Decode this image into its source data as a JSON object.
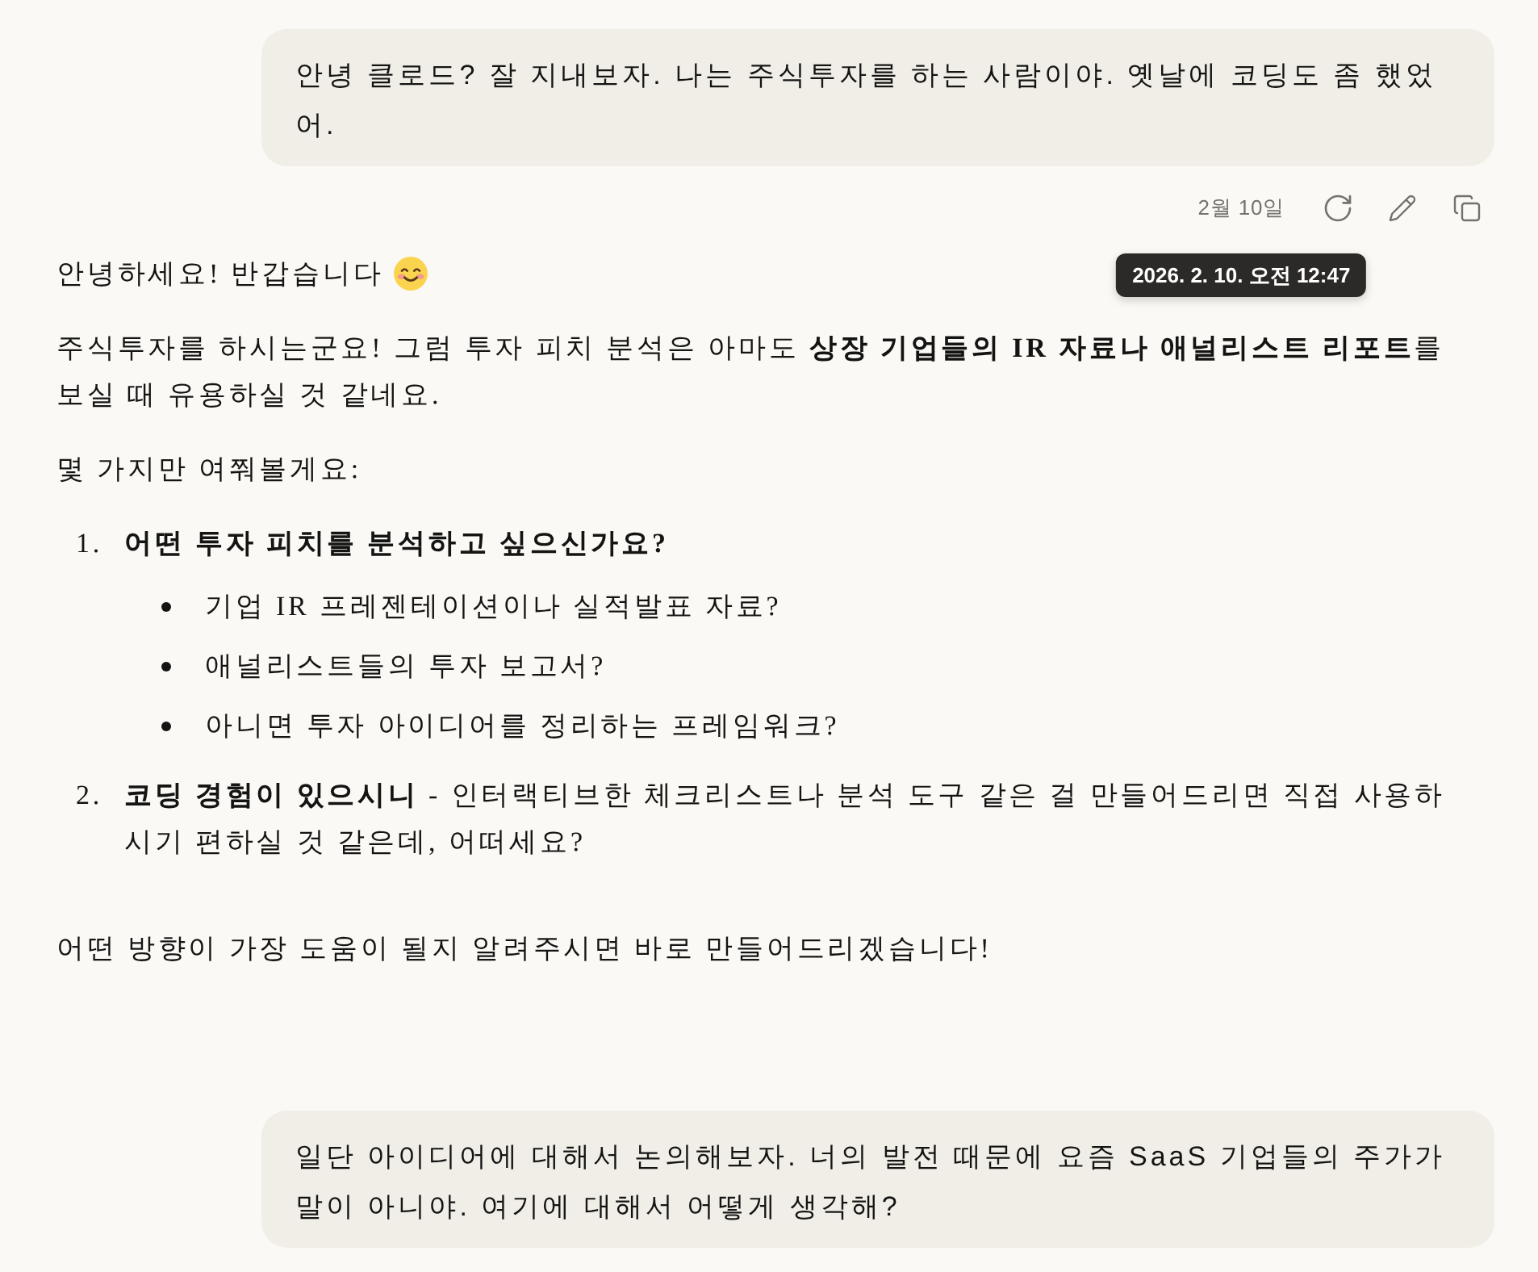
{
  "conversation": [
    {
      "kind": "user_message",
      "text": "안녕 클로드? 잘 지내보자. 나는 주식투자를 하는 사람이야. 옛날에 코딩도 좀 했었어."
    },
    {
      "kind": "message_meta",
      "date": "2월 10일",
      "tooltip": "2026. 2. 10. 오전 12:47"
    },
    {
      "kind": "assistant_message",
      "blocks": [
        {
          "kind": "paragraph",
          "text": "안녕하세요! 반갑습니다",
          "emoji": true
        },
        {
          "kind": "paragraph",
          "text": "주식투자를 하시는군요! 그럼 투자 피치 분석은 아마도 **상장 기업들의 IR 자료나 애널리스트 리포트**를 보실 때 유용하실 것 같네요."
        },
        {
          "kind": "paragraph",
          "text": "몇 가지만 여쭤볼게요:"
        },
        {
          "kind": "numbered_list",
          "items": [
            {
              "number": "1.",
              "text": "**어떤 투자 피치를 분석하고 싶으신가요?**",
              "children": [
                {
                  "text": "기업 IR 프레젠테이션이나 실적발표 자료?"
                },
                {
                  "text": "애널리스트들의 투자 보고서?"
                },
                {
                  "text": "아니면 투자 아이디어를 정리하는 프레임워크?"
                }
              ]
            },
            {
              "number": "2.",
              "text": "**코딩 경험이 있으시니** - 인터랙티브한 체크리스트나 분석 도구 같은 걸 만들어드리면 직접 사용하시기 편하실 것 같은데, 어떠세요?"
            }
          ]
        },
        {
          "kind": "paragraph",
          "text": "어떤 방향이 가장 도움이 될지 알려주시면 바로 만들어드리겠습니다!"
        }
      ]
    },
    {
      "kind": "user_message",
      "text": "일단 아이디어에 대해서 논의해보자. 너의 발전 때문에 요즘 SaaS 기업들의 주가가 말이 아니야. 여기에 대해서 어떻게 생각해?"
    }
  ]
}
